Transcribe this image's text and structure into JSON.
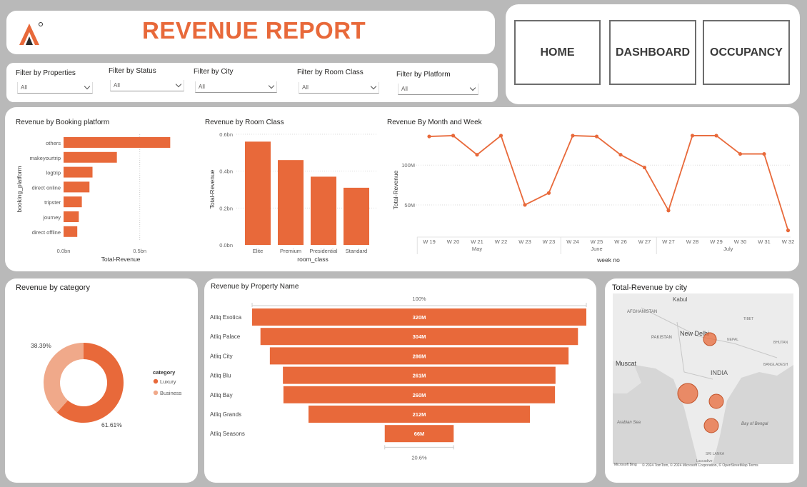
{
  "header": {
    "title": "REVENUE REPORT",
    "logo_icon": "atliq-logo-icon"
  },
  "nav": {
    "home": "HOME",
    "dashboard": "DASHBOARD",
    "occupancy": "OCCUPANCY"
  },
  "filters": [
    {
      "label": "Filter by Properties",
      "value": "All"
    },
    {
      "label": "Filter by Status",
      "value": "All"
    },
    {
      "label": "Filter by City",
      "value": "All"
    },
    {
      "label": "Filter by Room Class",
      "value": "All"
    },
    {
      "label": "Filter by Platform",
      "value": "All"
    }
  ],
  "colors": {
    "accent": "#e8693a",
    "business": "#f0a98a",
    "background": "#b9b9b9"
  },
  "chart_data": [
    {
      "type": "bar",
      "orientation": "horizontal",
      "title": "Revenue by Booking platform",
      "xlabel": "Total-Revenue",
      "ylabel": "booking_platform",
      "categories": [
        "others",
        "makeyourtrip",
        "logtrip",
        "direct online",
        "tripster",
        "journey",
        "direct offline"
      ],
      "values": [
        0.7,
        0.35,
        0.19,
        0.17,
        0.12,
        0.1,
        0.09
      ],
      "xticks": [
        "0.0bn",
        "0.5bn"
      ],
      "xlim": [
        0,
        0.75
      ]
    },
    {
      "type": "bar",
      "title": "Revenue by Room Class",
      "xlabel": "room_class",
      "ylabel": "Total-Revenue",
      "categories": [
        "Elite",
        "Premium",
        "Presidential",
        "Standard"
      ],
      "values": [
        0.56,
        0.46,
        0.37,
        0.31
      ],
      "yticks": [
        "0.0bn",
        "0.2bn",
        "0.4bn",
        "0.6bn"
      ],
      "ylim": [
        0,
        0.6
      ]
    },
    {
      "type": "line",
      "title": "Revenue By Month and Week",
      "xlabel": "week no",
      "ylabel": "Total-Revenue",
      "x": [
        "W 19",
        "W 20",
        "W 21",
        "W 22",
        "W 23",
        "W 23",
        "W 24",
        "W 25",
        "W 26",
        "W 27",
        "W 27",
        "W 28",
        "W 29",
        "W 30",
        "W 31",
        "W 32"
      ],
      "values": [
        136,
        137,
        113,
        137,
        50,
        65,
        137,
        136,
        113,
        97,
        43,
        137,
        137,
        114,
        114,
        18
      ],
      "months": [
        {
          "label": "May",
          "at": 2
        },
        {
          "label": "June",
          "at": 7
        },
        {
          "label": "July",
          "at": 12.5
        }
      ],
      "yticks": [
        "50M",
        "100M"
      ],
      "ylim": [
        15,
        145
      ]
    },
    {
      "type": "pie",
      "donut": true,
      "title": "Revenue by category",
      "legend_title": "category",
      "categories": [
        "Luxury",
        "Business"
      ],
      "values": [
        61.61,
        38.39
      ],
      "labels": [
        "61.61%",
        "38.39%"
      ]
    },
    {
      "type": "bar",
      "subtype": "funnel",
      "title": "Revenue by Property Name",
      "categories": [
        "Atliq Exotica",
        "Atliq Palace",
        "Atliq City",
        "Atliq Blu",
        "Atliq Bay",
        "Atliq Grands",
        "Atliq Seasons"
      ],
      "values": [
        320,
        304,
        286,
        261,
        260,
        212,
        66
      ],
      "labels": [
        "320M",
        "304M",
        "286M",
        "261M",
        "260M",
        "212M",
        "66M"
      ],
      "top_label": "100%",
      "bottom_label": "20.6%"
    }
  ],
  "map": {
    "title": "Total-Revenue by city",
    "place_labels": [
      "Kabul",
      "AFGHANISTAN",
      "TIBET",
      "PAKISTAN",
      "New Delhi",
      "NEPAL",
      "BHUTAN",
      "Muscat",
      "INDIA",
      "BANGLADESH",
      "Arabian Sea",
      "Bay of Bengal",
      "SRI LANKA",
      "Laccadive"
    ],
    "footer": "© 2024 TomTom, © 2024 Microsoft Corporation, © OpenStreetMap  Terms",
    "brand": "Microsoft Bing"
  }
}
